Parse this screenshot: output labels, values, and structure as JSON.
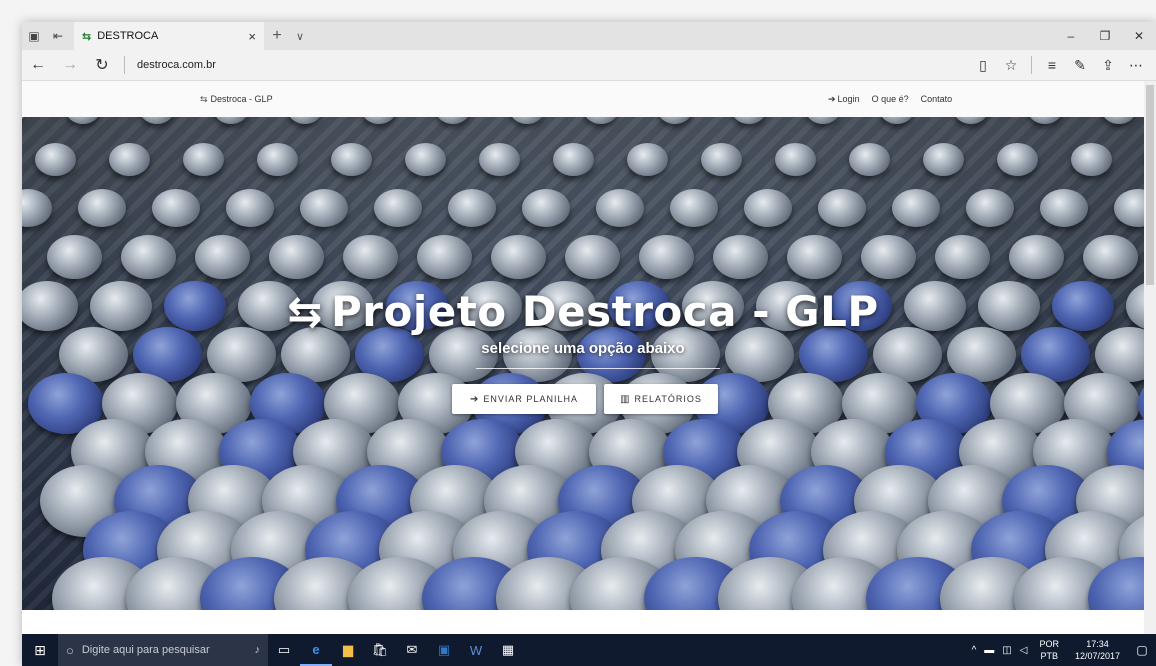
{
  "browser": {
    "tab_title": "DESTROCA",
    "url": "destroca.com.br",
    "new_tab": "+",
    "tab_menu": "∨"
  },
  "site": {
    "brand": "Destroca - GLP",
    "nav": {
      "login": "Login",
      "about": "O que é?",
      "contact": "Contato"
    }
  },
  "hero": {
    "title": "Projeto Destroca - GLP",
    "subtitle": "selecione uma opção abaixo",
    "buttons": {
      "enviar": "ENVIAR PLANILHA",
      "relatorios": "RELATÓRIOS"
    }
  },
  "taskbar": {
    "search_placeholder": "Digite aqui para pesquisar",
    "lang_line1": "POR",
    "lang_line2": "PTB",
    "time": "17:34",
    "date": "12/07/2017"
  },
  "icons": [
    "tab-preview-icon",
    "tab-aside-icon",
    "destroca-favicon",
    "back-icon",
    "forward-icon",
    "refresh-icon",
    "reading-view-icon",
    "favorite-star-icon",
    "hub-icon",
    "notes-icon",
    "share-icon",
    "more-icon",
    "login-icon",
    "chart-icon",
    "windows-start-icon",
    "cortana-icon",
    "mic-icon",
    "task-view-icon",
    "edge-icon",
    "explorer-icon",
    "store-icon",
    "mail-icon",
    "outlook-icon",
    "word-icon",
    "calculator-icon"
  ],
  "colors": {
    "accent": "#4f66b3",
    "taskbar": "#101a2e"
  }
}
